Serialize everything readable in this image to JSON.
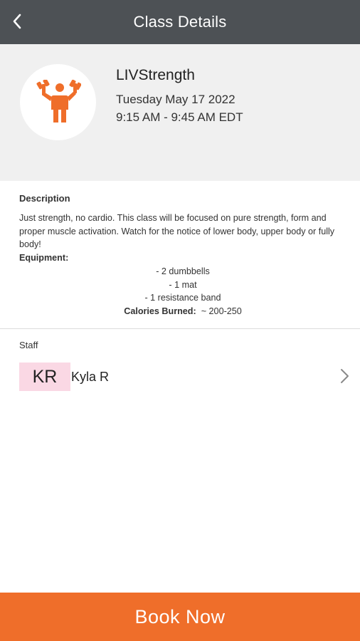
{
  "header": {
    "title": "Class Details",
    "back_icon": "chevron-left-icon"
  },
  "class": {
    "icon": "weightlifter-icon",
    "icon_color": "#ef6e2a",
    "name": "LIVStrength",
    "date": "Tuesday May 17 2022",
    "time": "9:15 AM - 9:45 AM EDT"
  },
  "description": {
    "label": "Description",
    "text": "Just strength, no cardio. This class will be focused on pure strength, form and proper muscle activation. Watch for the notice of lower body, upper body or fully body!",
    "equipment_label": "Equipment:",
    "equipment": [
      "- 2 dumbbells",
      "- 1 mat",
      "- 1 resistance band"
    ],
    "calories_label": "Calories Burned:",
    "calories_value": "~ 200-250"
  },
  "staff": {
    "label": "Staff",
    "initials": "KR",
    "name": "Kyla R",
    "avatar_color": "#fad8e4",
    "chevron_icon": "chevron-right-icon"
  },
  "actions": {
    "book_label": "Book Now",
    "book_color": "#ef6e2a"
  }
}
